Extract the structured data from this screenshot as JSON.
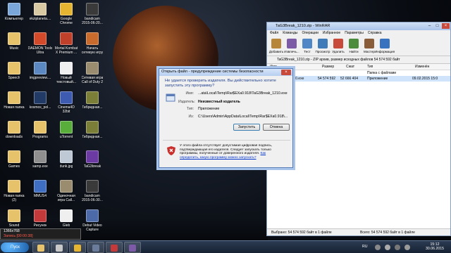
{
  "desktop": {
    "icons": [
      {
        "label": "Компьютер",
        "color": "#7aa7d8"
      },
      {
        "label": "ekziplaneta....",
        "color": "#d9c9a3"
      },
      {
        "label": "Google\nChrome",
        "color": "#e5b431"
      },
      {
        "label": "bandicam\n2015-06-20...",
        "color": "#3a3a3a"
      },
      {
        "label": "Music",
        "color": "#e6c36b"
      },
      {
        "label": "DAEMON Tools\nUltra",
        "color": "#d34a2b"
      },
      {
        "label": "Mortal Kombat\nX Premium ...",
        "color": "#c0402a"
      },
      {
        "label": "Начать\nсетевую игру",
        "color": "#c96b2c"
      },
      {
        "label": "Speech",
        "color": "#e6c36b"
      },
      {
        "label": "imgpreview....",
        "color": "#5c88c1"
      },
      {
        "label": "Новый\nтекстовый...",
        "color": "#efefef"
      },
      {
        "label": "Сетевая игра\nCall of Duty 2",
        "color": "#9a8c6e"
      },
      {
        "label": "Новая папка",
        "color": "#e6c36b"
      },
      {
        "label": "kosmos_pol...",
        "color": "#223a66"
      },
      {
        "label": "Cinema4D\n32bit",
        "color": "#3d5bb0"
      },
      {
        "label": "Гибридная...",
        "color": "#7b7e36"
      },
      {
        "label": "downloads",
        "color": "#e6c36b"
      },
      {
        "label": "Programs",
        "color": "#e6c36b"
      },
      {
        "label": "uTorrent",
        "color": "#58ad3b"
      },
      {
        "label": "Гибридная...",
        "color": "#7b7e36"
      },
      {
        "label": "Games",
        "color": "#e6c36b"
      },
      {
        "label": "samp.exe",
        "color": "#8f8f8f"
      },
      {
        "label": "dunk.jpg",
        "color": "#bfc9d6"
      },
      {
        "label": "TaG3break",
        "color": "#6b3aa3"
      },
      {
        "label": "Новая папка\n(2)",
        "color": "#e6c36b"
      },
      {
        "label": "MMUS4",
        "color": "#3f6fc2"
      },
      {
        "label": "Одиночная\nигра Call...",
        "color": "#9a8c6e"
      },
      {
        "label": "bandicam\n2015-06-30...",
        "color": "#3a3a3a"
      },
      {
        "label": "Sound",
        "color": "#e6c36b"
      },
      {
        "label": "Рисунок",
        "color": "#c43a3a"
      },
      {
        "label": "Gleb",
        "color": "#efefef"
      },
      {
        "label": "Debut Video\nCapture",
        "color": "#4d6aa8"
      }
    ]
  },
  "dialog": {
    "title": "Открыть файл - предупреждение системы безопасности",
    "heading": "Не удается проверить издателя. Вы действительно хотите запустить эту программу?",
    "fields": [
      {
        "key": "Имя:",
        "value": "...ata\\Local\\Temp\\Rar$EXa0.918\\TaG3Break_1210.exe"
      },
      {
        "key": "Издатель:",
        "value": "Неизвестный издатель"
      },
      {
        "key": "Тип:",
        "value": "Приложение"
      },
      {
        "key": "Из:",
        "value": "C:\\Users\\Admin\\AppData\\Local\\Temp\\Rar$EXa0.918\\..."
      }
    ],
    "run_label": "Запустить",
    "cancel_label": "Отмена",
    "footer_text": "У этого файла отсутствует допустимая цифровая подпись, подтверждающая его издателя. Следует запускать только программы, полученные от доверенного издателя.",
    "footer_link": "Как определить, какую программу можно запускать?"
  },
  "winrar": {
    "title": "TaG3Break_1210.zip - WinRAR",
    "menu": [
      "Файл",
      "Команды",
      "Операции",
      "Избранное",
      "Параметры",
      "Справка"
    ],
    "tools": [
      {
        "label": "Добавить",
        "color": "#b8863b"
      },
      {
        "label": "Извлечь...",
        "color": "#7c5aa8"
      },
      {
        "label": "Тест",
        "color": "#4f86c6"
      },
      {
        "label": "Просмотр",
        "color": "#3e7bb8"
      },
      {
        "label": "Удалить",
        "color": "#c74a3a"
      },
      {
        "label": "Найти",
        "color": "#4b8d3c"
      },
      {
        "label": "Мастер",
        "color": "#8a5d3a"
      },
      {
        "label": "Информация",
        "color": "#3973c0"
      }
    ],
    "path": "TaG3Break_1210.zip - ZIP архив, размер исходных файлов 54 574 592 байт",
    "columns": [
      "Имя",
      "Размер",
      "Сжат",
      "Тип",
      "Изменён"
    ],
    "rows": [
      {
        "name": "..",
        "size": "",
        "packed": "",
        "type": "Папка с файлами",
        "date": ""
      },
      {
        "name": "TaG3Break_1210.exe",
        "size": "54 574 592",
        "packed": "52 666 404",
        "type": "Приложение",
        "date": "09.02.2015 15:0"
      }
    ],
    "status_left": "Выбрано: 54 574 592 байт в 1 файле",
    "status_right": "Всего: 54 574 592 байт в 1 файле"
  },
  "recorder": {
    "resolution": "1366x768",
    "rec_label": "Запись [00:00:38]"
  },
  "taskbar": {
    "start_label": "Пуск",
    "apps": [
      {
        "name": "explorer",
        "color": "#e6c36b"
      },
      {
        "name": "player",
        "color": "#c8c8c8"
      },
      {
        "name": "chrome",
        "color": "#e5b431"
      },
      {
        "name": "steam",
        "color": "#6a7c99"
      },
      {
        "name": "bandicam",
        "color": "#c43a3a"
      },
      {
        "name": "winrar",
        "color": "#7c5aa8"
      }
    ],
    "lang": "RU",
    "time": "15:12",
    "date": "30.06.2015"
  }
}
